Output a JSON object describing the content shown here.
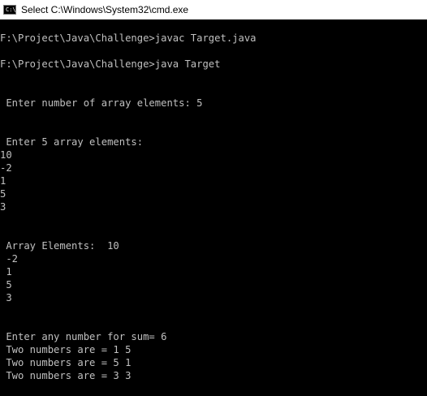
{
  "window": {
    "title": "Select C:\\Windows\\System32\\cmd.exe",
    "icon": "cmd-icon",
    "icon_glyph": "C:\\"
  },
  "console": {
    "lines": [
      "F:\\Project\\Java\\Challenge>javac Target.java",
      "F:\\Project\\Java\\Challenge>java Target",
      " Enter number of array elements: 5",
      " Enter 5 array elements:",
      "10",
      "-2",
      "1",
      "5",
      "3",
      " Array Elements:  10",
      " -2",
      " 1",
      " 5",
      " 3",
      " Enter any number for sum= 6",
      " Two numbers are = 1 5",
      " Two numbers are = 5 1",
      " Two numbers are = 3 3"
    ]
  },
  "colors": {
    "background": "#000000",
    "text": "#c0c0c0",
    "titlebar": "#ffffff"
  }
}
